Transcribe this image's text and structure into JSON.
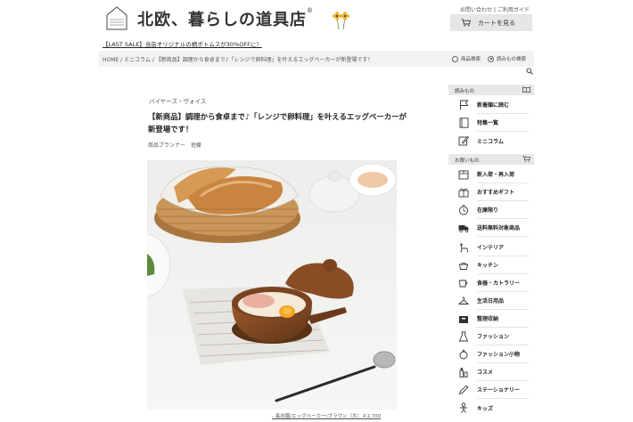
{
  "header": {
    "logo_small_text": "HOKUOH KURASHI NO DOUGUTEN",
    "site_title": "北欧、暮らしの道具店",
    "registered_mark": "®",
    "util_links": [
      "お問い合わせ",
      "|",
      "ご利用ガイド"
    ],
    "cart_button_label": "カートを見る"
  },
  "sale_banner": "【LAST SALE】当店オリジナルの柄ボトムスが30%OFFに！",
  "breadcrumb": {
    "text": "HOME / ミニコラム / 【新商品】調理から食卓まで♪「レンジで卵料理」を叶えるエッグベーカーが新登場です！"
  },
  "search": {
    "options": [
      {
        "label": "商品検索",
        "selected": false
      },
      {
        "label": "読みもの検索",
        "selected": true
      }
    ]
  },
  "article": {
    "category": "バイヤーズ・ヴォイス",
    "title": "【新商品】調理から食卓まで♪「レンジで卵料理」を叶えるエッグベーカーが新登場です！",
    "byline": "商品プランナー　佐藤",
    "caption": "- 長谷園/エッグベーカー/ブラウン（大）￥2,700"
  },
  "sidebar": {
    "reading_header": "読みもの",
    "reading_items": [
      {
        "label": "新着順に読む",
        "icon": "flag-icon"
      },
      {
        "label": "特集一覧",
        "icon": "book-icon"
      },
      {
        "label": "ミニコラム",
        "icon": "pencil-square-icon"
      }
    ],
    "shopping_header": "お買いもの",
    "shopping_items": [
      {
        "label": "新入荷・再入荷",
        "icon": "truck-icon"
      },
      {
        "label": "おすすめギフト",
        "icon": "gift-icon"
      },
      {
        "label": "在庫限り",
        "icon": "clock-icon"
      },
      {
        "label": "送料無料対象商品",
        "icon": "free-shipping-icon"
      },
      {
        "label": "インテリア",
        "icon": "chair-icon"
      },
      {
        "label": "キッチン",
        "icon": "pot-icon"
      },
      {
        "label": "食器・カトラリー",
        "icon": "cup-icon"
      },
      {
        "label": "生活日用品",
        "icon": "hanger-icon"
      },
      {
        "label": "整理収納",
        "icon": "box-icon"
      },
      {
        "label": "ファッション",
        "icon": "dress-icon"
      },
      {
        "label": "ファッション小物",
        "icon": "bag-icon"
      },
      {
        "label": "コスメ",
        "icon": "bottle-icon"
      },
      {
        "label": "ステーショナリー",
        "icon": "pen-icon"
      },
      {
        "label": "キッズ",
        "icon": "kids-icon"
      }
    ]
  }
}
